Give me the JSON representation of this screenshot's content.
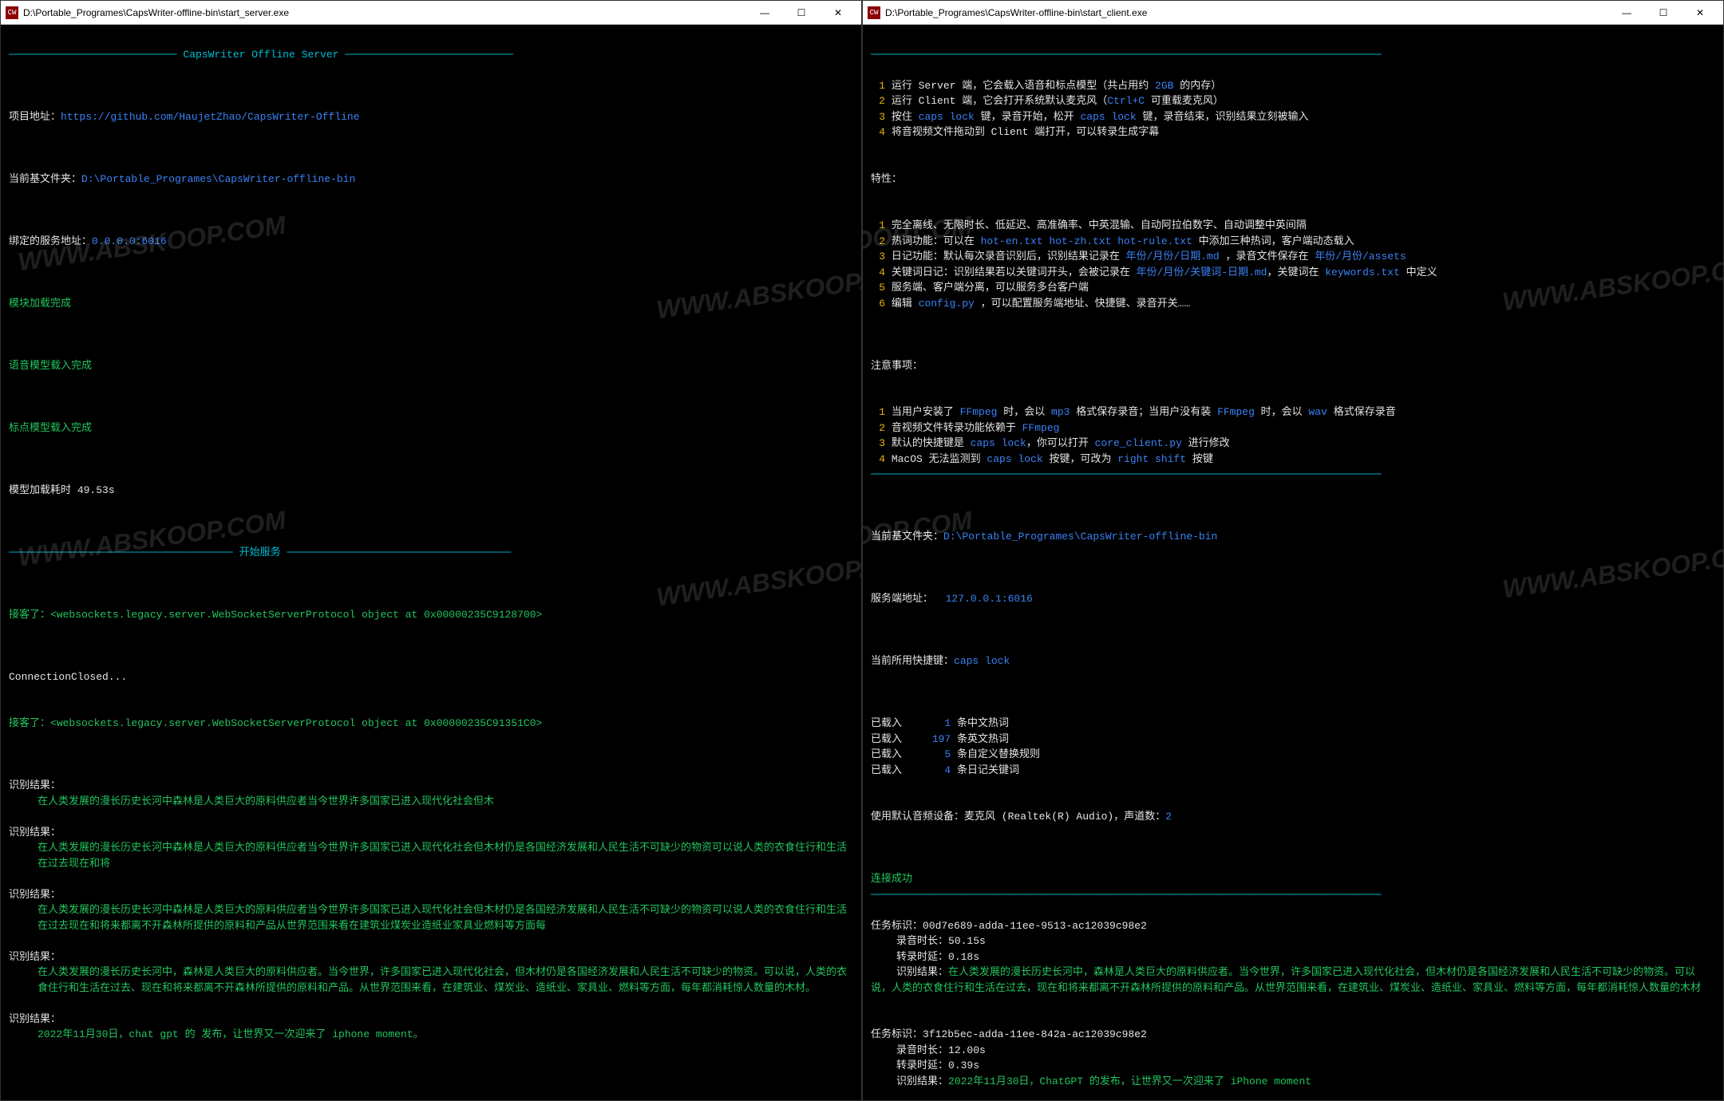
{
  "left": {
    "title": "D:\\Portable_Programes\\CapsWriter-offline-bin\\start_server.exe",
    "icon_label": "CW",
    "banner": "─────────────────────────── CapsWriter Offline Server ───────────────────────────",
    "project_label": "项目地址：",
    "project_url": "https://github.com/HaujetZhao/CapsWriter-Offline",
    "base_folder_label": "当前基文件夹：",
    "base_folder": "D:\\Portable_Programes\\CapsWriter-offline-bin",
    "bind_label": "绑定的服务地址：",
    "bind_addr": "0.0.0.0:6016",
    "module_loaded": "模块加载完成",
    "voice_loaded": "语音模型载入完成",
    "punct_loaded": "标点模型载入完成",
    "time_label": "模型加载耗时 ",
    "time_value": "49.53s",
    "start_banner": "──────────────────────────────────── 开始服务 ────────────────────────────────────",
    "accept1a": "接客了：",
    "accept1b": "<websockets.legacy.server.WebSocketServerProtocol object at 0x00000235C9128700>",
    "conn_closed": "ConnectionClosed...",
    "accept2a": "接客了：",
    "accept2b": "<websockets.legacy.server.WebSocketServerProtocol object at 0x00000235C91351C0>",
    "result_label": "识别结果：",
    "r1": "在人类发展的漫长历史长河中森林是人类巨大的原料供应者当今世界许多国家已进入现代化社会但木",
    "r2": "在人类发展的漫长历史长河中森林是人类巨大的原料供应者当今世界许多国家已进入现代化社会但木材仍是各国经济发展和人民生活不可缺少的物资可以说人类的衣食住行和生活在过去现在和将",
    "r3": "在人类发展的漫长历史长河中森林是人类巨大的原料供应者当今世界许多国家已进入现代化社会但木材仍是各国经济发展和人民生活不可缺少的物资可以说人类的衣食住行和生活在过去现在和将来都离不开森林所提供的原料和产品从世界范围来看在建筑业煤炭业造纸业家具业燃料等方面每",
    "r4": "在人类发展的漫长历史长河中，森林是人类巨大的原料供应者。当今世界，许多国家已进入现代化社会，但木材仍是各国经济发展和人民生活不可缺少的物资。可以说，人类的衣食住行和生活在过去、现在和将来都离不开森林所提供的原料和产品。从世界范围来看，在建筑业、煤炭业、造纸业、家具业、燃料等方面，每年都消耗惊人数量的木材。",
    "r5": "2022年11月30日，chat gpt 的 发布，让世界又一次迎来了 iphone moment。"
  },
  "right": {
    "title": "D:\\Portable_Programes\\CapsWriter-offline-bin\\start_client.exe",
    "icon_label": "CW",
    "hr": "──────────────────────────────────────────────────────────────────────────────────",
    "usage": [
      {
        "n": "1",
        "pre": "运行 Server 端，它会载入语音和标点模型（共占用约 ",
        "h": "2GB",
        "post": " 的内存）"
      },
      {
        "n": "2",
        "pre": "运行 Client 端，它会打开系统默认麦克风（",
        "h": "Ctrl+C",
        "post": " 可重载麦克风）"
      },
      {
        "n": "3",
        "pre": "按住 ",
        "h": "caps lock",
        "mid": " 键，录音开始，松开 ",
        "h2": "caps lock",
        "post": " 键，录音结束，识别结果立刻被输入"
      },
      {
        "n": "4",
        "pre": "将音视频文件拖动到 Client 端打开，可以转录生成字幕",
        "h": "",
        "post": ""
      }
    ],
    "features_label": "特性：",
    "features": [
      {
        "n": "1",
        "text": "完全离线、无限时长、低延迟、高准确率、中英混输、自动阿拉伯数字、自动调整中英间隔"
      },
      {
        "n": "2",
        "pre": "热词功能：可以在 ",
        "h": "hot-en.txt hot-zh.txt hot-rule.txt",
        "post": " 中添加三种热词，客户端动态载入"
      },
      {
        "n": "3",
        "pre": "日记功能：默认每次录音识别后，识别结果记录在 ",
        "h": "年份/月份/日期.md",
        "post": " ，录音文件保存在 ",
        "h2": "年份/月份/assets"
      },
      {
        "n": "4",
        "pre": "关键词日记：识别结果若以关键词开头，会被记录在 ",
        "h": "年份/月份/关键词-日期.md",
        "post": "，关键词在 ",
        "h2": "keywords.txt",
        "post2": " 中定义"
      },
      {
        "n": "5",
        "text": "服务端、客户端分离，可以服务多台客户端"
      },
      {
        "n": "6",
        "pre": "编辑 ",
        "h": "config.py",
        "post": " ，可以配置服务端地址、快捷键、录音开关……"
      }
    ],
    "notes_label": "注意事项：",
    "notes": [
      {
        "n": "1",
        "pre": "当用户安装了 ",
        "h": "FFmpeg",
        "mid": " 时，会以 ",
        "h2": "mp3",
        "mid2": " 格式保存录音；当用户没有装 ",
        "h3": "FFmpeg",
        "mid3": " 时，会以 ",
        "h4": "wav",
        "post": " 格式保存录音"
      },
      {
        "n": "2",
        "pre": "音视频文件转录功能依赖于 ",
        "h": "FFmpeg"
      },
      {
        "n": "3",
        "pre": "默认的快捷键是 ",
        "h": "caps lock",
        "mid": "，你可以打开 ",
        "h2": "core_client.py",
        "post": " 进行修改"
      },
      {
        "n": "4",
        "pre": "MacOS 无法监测到 ",
        "h": "caps lock",
        "mid": " 按键，可改为 ",
        "h2": "right shift",
        "post": " 按键"
      }
    ],
    "base_folder_label": "当前基文件夹：",
    "base_folder": "D:\\Portable_Programes\\CapsWriter-offline-bin",
    "server_label": "服务端地址：  ",
    "server_addr": "127.0.0.1:6016",
    "hotkey_label": "当前所用快捷键：",
    "hotkey": "caps lock",
    "loaded_label": "已载入",
    "loaded": [
      {
        "n": "1",
        "text": "条中文热词"
      },
      {
        "n": "197",
        "text": "条英文热词"
      },
      {
        "n": "5",
        "text": "条自定义替换规则"
      },
      {
        "n": "4",
        "text": "条日记关键词"
      }
    ],
    "audio_label": "使用默认音频设备：麦克风 (Realtek(R) Audio)，声道数：",
    "audio_channels": "2",
    "conn_ok": "连接成功",
    "task1": {
      "id_label": "任务标识：",
      "id": "00d7e689-adda-11ee-9513-ac12039c98e2",
      "rec_label": "录音时长：",
      "rec": "50.15s",
      "trans_label": "转录时延：",
      "trans": "0.18s",
      "result_label": "识别结果：",
      "result": "在人类发展的漫长历史长河中，森林是人类巨大的原料供应者。当今世界，许多国家已进入现代化社会，但木材仍是各国经济发展和人民生活不可缺少的物资。可以说，人类的衣食住行和生活在过去，现在和将来都离不开森林所提供的原料和产品。从世界范围来看，在建筑业、煤炭业、造纸业、家具业、燃料等方面，每年都消耗惊人数量的木材"
    },
    "task2": {
      "id_label": "任务标识：",
      "id": "3f12b5ec-adda-11ee-842a-ac12039c98e2",
      "rec_label": "录音时长：",
      "rec": "12.00s",
      "trans_label": "转录时延：",
      "trans": "0.39s",
      "result_label": "识别结果：",
      "result": "2022年11月30日，ChatGPT 的发布，让世界又一次迎来了 iPhone moment"
    }
  },
  "watermark": "WWW.ABSKOOP.COM",
  "controls": {
    "min": "—",
    "max": "☐",
    "close": "✕"
  }
}
